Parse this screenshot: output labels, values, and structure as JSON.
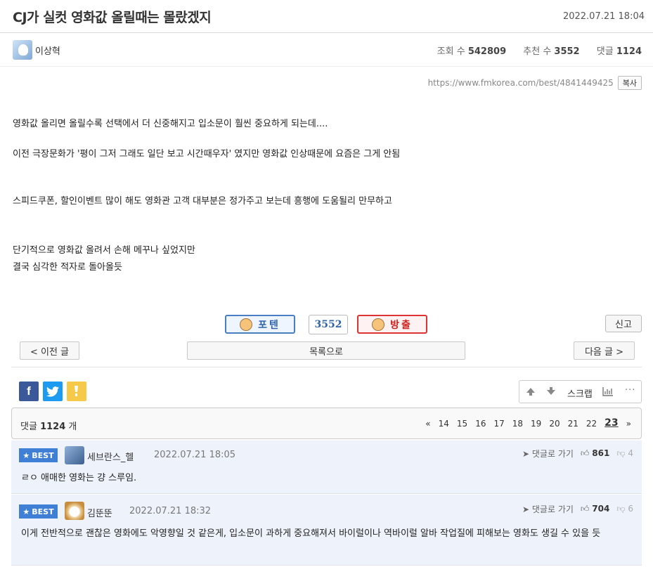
{
  "post": {
    "title": "CJ가 실컷 영화값 올릴때는 몰랐겠지",
    "date": "2022.07.21 18:04",
    "author": "이상혁",
    "views_label": "조회 수",
    "views": "542809",
    "recommend_label": "추천 수",
    "recommend": "3552",
    "comments_label": "댓글",
    "comments": "1124",
    "url": "https://www.fmkorea.com/best/4841449425",
    "copy_label": "복사",
    "body": [
      "영화값 올리면 올릴수록 선택에서 더 신중해지고 입소문이 훨씬 중요하게 되는데....",
      "이전 극장문화가 '평이 그저 그래도 일단 보고 시간때우자' 였지만 영화값 인상때문에 요즘은 그게 안됨",
      "스피드쿠폰, 할인이벤트 많이 해도 영화관 고객 대부분은 정가주고 보는데 흥행에 도움될리 만무하고",
      "단기적으로 영화값 올려서 손해 메꾸나 싶었지만",
      "결국 심각한 적자로 돌아올듯"
    ]
  },
  "votes": {
    "up_label": "포텐",
    "count": "3552",
    "down_label": "방출",
    "report_label": "신고"
  },
  "nav": {
    "prev_label": "< 이전 글",
    "list_label": "목록으로",
    "next_label": "다음 글 >"
  },
  "tools": {
    "scrap_label": "스크랩"
  },
  "comment_header": {
    "label": "댓글",
    "count": "1124",
    "unit": "개",
    "pages": [
      "«",
      "14",
      "15",
      "16",
      "17",
      "18",
      "19",
      "20",
      "21",
      "22",
      "23",
      "»"
    ],
    "current_page": "23"
  },
  "comments": [
    {
      "badge": "BEST",
      "name": "세브란스_헬",
      "date": "2022.07.21 18:05",
      "goto_label": "댓글로 가기",
      "likes": "861",
      "dislikes": "4",
      "text": "ㄹㅇ 애매한 영화는 걍 스루임."
    },
    {
      "badge": "BEST",
      "name": "김뚠뚠",
      "date": "2022.07.21 18:32",
      "goto_label": "댓글로 가기",
      "likes": "704",
      "dislikes": "6",
      "text": "이게 전반적으로 괜찮은 영화에도 악영향일 것 같은게, 입소문이 과하게 중요해져서 바이럴이나 역바이럴 알바 작업질에 피해보는 영화도 생길 수 있을 듯"
    }
  ]
}
